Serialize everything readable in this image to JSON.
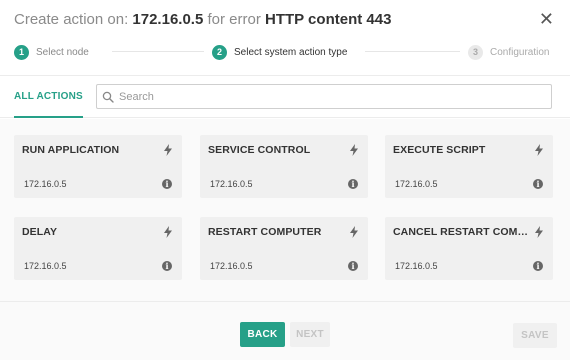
{
  "dialog": {
    "title_prefix": "Create action on: ",
    "host": "172.16.0.5",
    "title_middle": " for error ",
    "error_name": "HTTP content 443",
    "close_glyph": "✕"
  },
  "stepper": {
    "steps": [
      {
        "number": "1",
        "label": "Select node",
        "state": "done"
      },
      {
        "number": "2",
        "label": "Select system action type",
        "state": "active"
      },
      {
        "number": "3",
        "label": "Configuration",
        "state": "pending"
      }
    ]
  },
  "toolbar": {
    "tab_label": "ALL ACTIONS",
    "search_placeholder": "Search",
    "search_value": ""
  },
  "actions": [
    {
      "name": "RUN APPLICATION",
      "host": "172.16.0.5"
    },
    {
      "name": "SERVICE CONTROL",
      "host": "172.16.0.5"
    },
    {
      "name": "EXECUTE SCRIPT",
      "host": "172.16.0.5"
    },
    {
      "name": "DELAY",
      "host": "172.16.0.5"
    },
    {
      "name": "RESTART COMPUTER",
      "host": "172.16.0.5"
    },
    {
      "name": "CANCEL RESTART COMPUTER",
      "host": "172.16.0.5"
    }
  ],
  "footer": {
    "back_label": "BACK",
    "next_label": "NEXT",
    "save_label": "SAVE"
  },
  "colors": {
    "accent": "#26a088",
    "disabled_text": "#c4c4c4",
    "card_bg": "#f0f0f0"
  },
  "icons": {
    "action": "bolt-icon",
    "info": "info-icon",
    "search": "search-icon",
    "close": "close-icon"
  }
}
